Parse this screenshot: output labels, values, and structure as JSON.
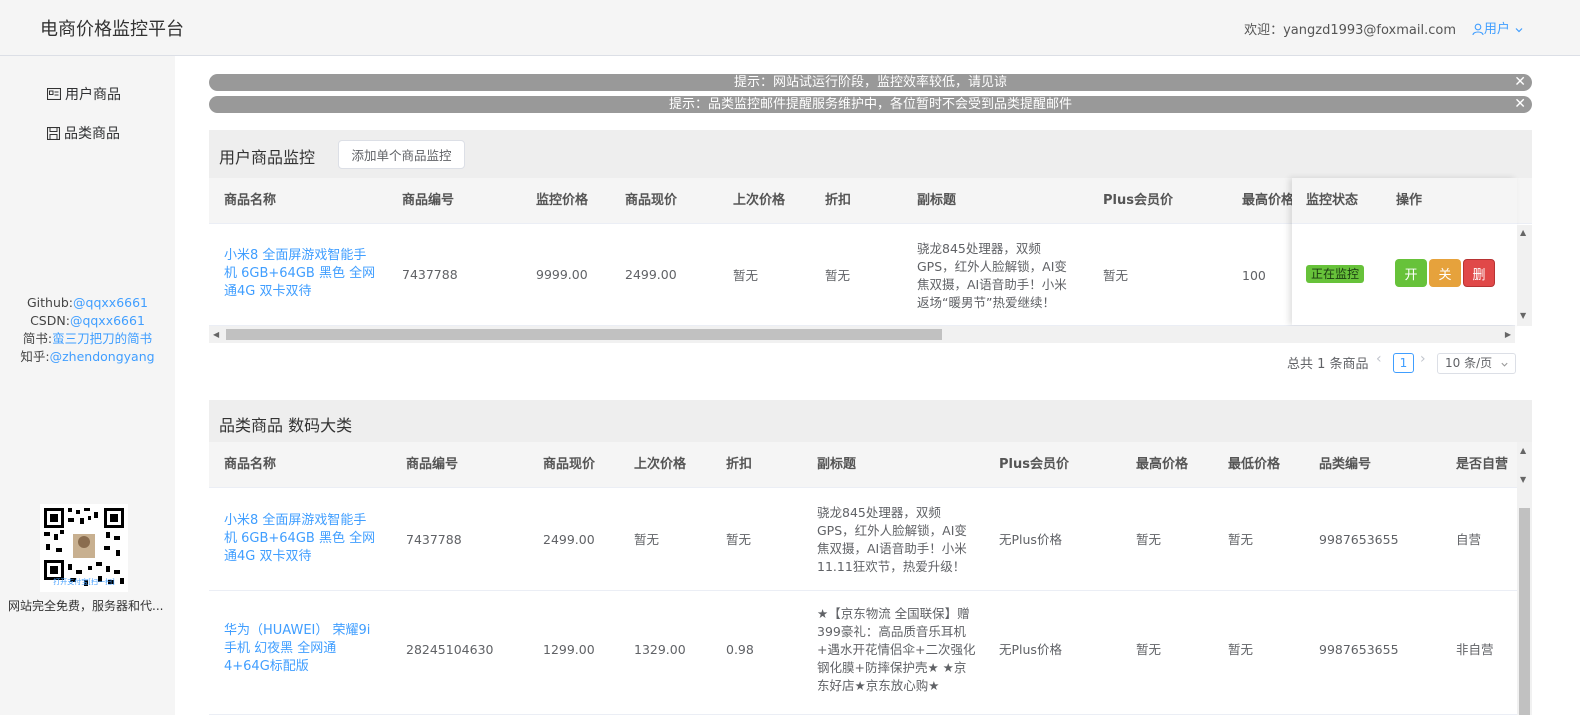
{
  "app": {
    "title": "电商价格监控平台"
  },
  "header": {
    "welcome": "欢迎：yangzd1993@foxmail.com",
    "user_label": "用户"
  },
  "sidebar": {
    "items": [
      {
        "label": "用户商品",
        "icon": "id-card-icon"
      },
      {
        "label": "品类商品",
        "icon": "save-icon"
      }
    ],
    "social": {
      "github_prefix": "Github:",
      "github_link": "@qqxx6661",
      "csdn_prefix": "CSDN:",
      "csdn_link": "@qqxx6661",
      "jianshu_prefix": "简书:",
      "jianshu_link": "蛮三刀把刀的简书",
      "zhihu_prefix": "知乎:",
      "zhihu_link": "@zhendongyang"
    },
    "qr_caption": "打开支付宝[扫一扫]",
    "free_text": "网站完全免费，服务器和代..."
  },
  "alerts": [
    "提示：网站试运行阶段，监控效率较低，请见谅",
    "提示：品类监控邮件提醒服务维护中，各位暂时不会受到品类提醒邮件"
  ],
  "user_section": {
    "title": "用户商品监控",
    "add_button": "添加单个商品监控",
    "columns": [
      "商品名称",
      "商品编号",
      "监控价格",
      "商品现价",
      "上次价格",
      "折扣",
      "副标题",
      "Plus会员价",
      "最高价格",
      "监控状态",
      "操作"
    ],
    "rows": [
      {
        "name": "小米8 全面屏游戏智能手机 6GB+64GB 黑色 全网通4G 双卡双待",
        "id": "7437788",
        "monitor_price": "9999.00",
        "current_price": "2499.00",
        "last_price": "暂无",
        "discount": "暂无",
        "subtitle": "骁龙845处理器，双频GPS，红外人脸解锁，AI变焦双摄，AI语音助手！小米返场“暖男节”热爱继续！",
        "plus_price": "暂无",
        "max_price": "100",
        "status": "正在监控",
        "btn_on": "开",
        "btn_off": "关",
        "btn_delete": "删"
      }
    ],
    "pagination": {
      "total": "总共 1 条商品",
      "current_page": "1",
      "page_size": "10 条/页"
    }
  },
  "category_section": {
    "title": "品类商品 数码大类",
    "columns": [
      "商品名称",
      "商品编号",
      "商品现价",
      "上次价格",
      "折扣",
      "副标题",
      "Plus会员价",
      "最高价格",
      "最低价格",
      "品类编号",
      "是否自营"
    ],
    "rows": [
      {
        "name": "小米8 全面屏游戏智能手机 6GB+64GB 黑色 全网通4G 双卡双待",
        "id": "7437788",
        "current_price": "2499.00",
        "last_price": "暂无",
        "discount": "暂无",
        "subtitle": "骁龙845处理器，双频GPS，红外人脸解锁，AI变焦双摄，AI语音助手！小米11.11狂欢节，热爱升级！",
        "plus_price": "无Plus价格",
        "max_price": "暂无",
        "min_price": "暂无",
        "category_id": "9987653655",
        "self_operated": "自营"
      },
      {
        "name": "华为（HUAWEI） 荣耀9i手机 幻夜黑 全网通4+64G标配版",
        "id": "28245104630",
        "current_price": "1299.00",
        "last_price": "1329.00",
        "discount": "0.98",
        "subtitle": "★【京东物流 全国联保】赠399豪礼：高品质音乐耳机+遇水开花情侣伞+二次强化钢化膜+防摔保护壳★ ★京东好店★京东放心购★",
        "plus_price": "无Plus价格",
        "max_price": "暂无",
        "min_price": "暂无",
        "category_id": "9987653655",
        "self_operated": "非自营"
      }
    ]
  },
  "colors": {
    "primary": "#409eff",
    "success": "#67c23a",
    "warning": "#e6a23c",
    "danger": "#f56c6c",
    "alert_bg": "#999999"
  }
}
